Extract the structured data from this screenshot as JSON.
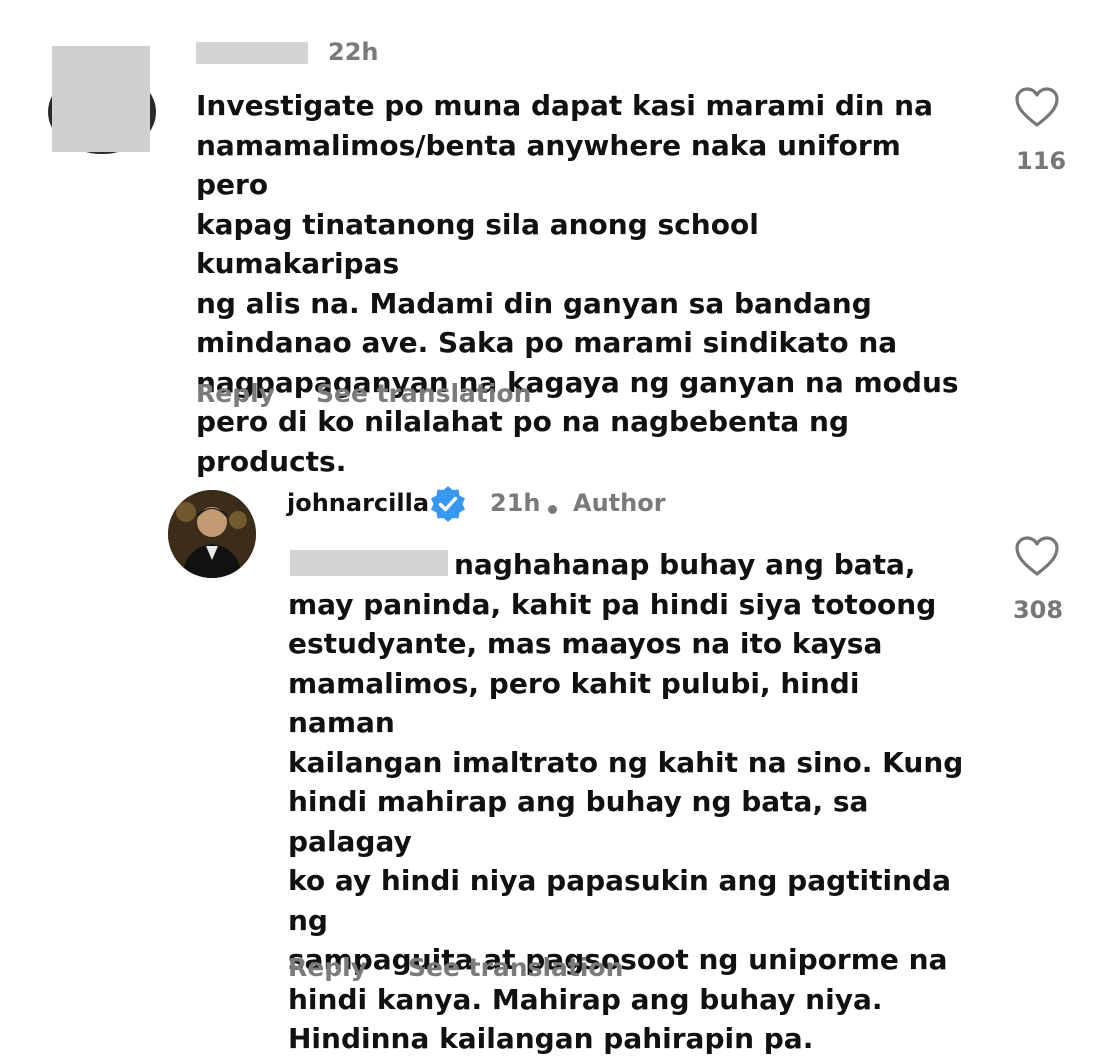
{
  "comment1": {
    "time": "22h",
    "text": "Investigate po muna dapat kasi marami din na\nnamamalimos/benta anywhere naka uniform pero\nkapag tinatanong sila anong school kumakaripas\nng alis na. Madami din ganyan sa bandang\nmindanao ave. Saka po marami sindikato na\nnagpapaganyan na kagaya ng ganyan na modus\npero di ko nilalahat po na nagbebenta ng products.",
    "reply_label": "Reply",
    "translate_label": "See translation",
    "like_count": "116",
    "like_icon": "heart-outline-icon"
  },
  "comment2": {
    "username": "johnarcilla",
    "time": "21h",
    "author_badge": "Author",
    "text": "naghahanap buhay ang bata,\nmay paninda, kahit pa hindi siya totoong\nestudyante, mas maayos na ito kaysa\nmamalimos, pero kahit pulubi, hindi naman\nkailangan imaltrato ng kahit na sino. Kung\nhindi mahirap ang buhay ng bata, sa palagay\nko ay hindi niya papasukin ang pagtitinda ng\nsampaguita at pagsosoot ng uniporme na\nhindi kanya. Mahirap ang buhay niya.\nHindinna kailangan pahirapin pa.",
    "reply_label": "Reply",
    "translate_label": "See translation",
    "like_count": "308",
    "like_icon": "heart-outline-icon",
    "verified_color": "#3897f0"
  }
}
